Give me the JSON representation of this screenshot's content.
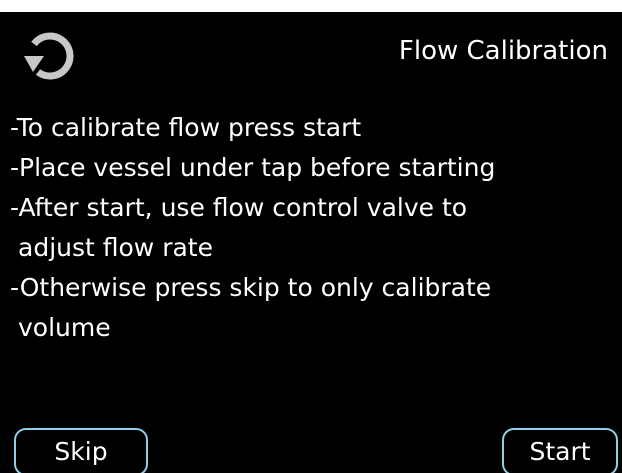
{
  "header": {
    "back_icon": "circular-arrow-back-icon",
    "title": "Flow Calibration"
  },
  "instructions": [
    "-To calibrate flow press start",
    "-Place vessel under tap before starting",
    "-After start, use flow control valve to",
    "adjust flow rate",
    "-Otherwise press skip to only calibrate",
    "volume"
  ],
  "buttons": {
    "skip_label": "Skip",
    "start_label": "Start"
  },
  "colors": {
    "background": "#000000",
    "text": "#ffffff",
    "button_border": "#8fd0e8",
    "icon": "#c8c8c8"
  }
}
